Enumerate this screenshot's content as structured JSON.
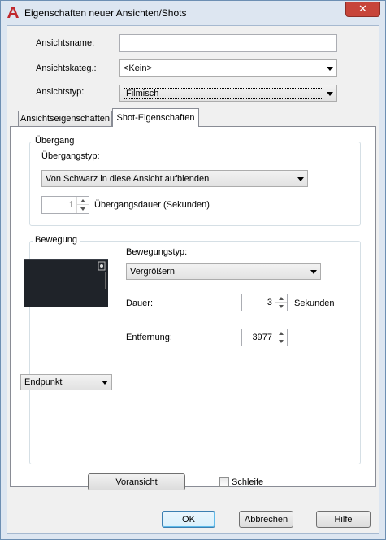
{
  "window": {
    "title": "Eigenschaften neuer Ansichten/Shots",
    "close_glyph": "✕"
  },
  "fields": {
    "name_label": "Ansichtsname:",
    "name_value": "",
    "category_label": "Ansichtskateg.:",
    "category_value": "<Kein>",
    "type_label": "Ansichtstyp:",
    "type_value": "Filmisch"
  },
  "tabs": [
    {
      "label": "Ansichtseigenschaften",
      "active": false
    },
    {
      "label": "Shot-Eigenschaften",
      "active": true
    }
  ],
  "transition": {
    "group_title": "Übergang",
    "type_label": "Übergangstyp:",
    "type_value": "Von Schwarz in diese Ansicht aufblenden",
    "duration_value": "1",
    "duration_label": "Übergangsdauer (Sekunden)"
  },
  "motion": {
    "group_title": "Bewegung",
    "type_label": "Bewegungstyp:",
    "type_value": "Vergrößern",
    "duration_label": "Dauer:",
    "duration_value": "3",
    "duration_unit": "Sekunden",
    "distance_label": "Entfernung:",
    "distance_value": "3977",
    "point_value": "Endpunkt"
  },
  "preview_button": "Voransicht",
  "loop_label": "Schleife",
  "loop_checked": false,
  "buttons": {
    "ok": "OK",
    "cancel": "Abbrechen",
    "help": "Hilfe"
  },
  "colors": {
    "accent": "#c7453a",
    "app_icon": "#c0282d",
    "frame": "#dde6f1"
  }
}
